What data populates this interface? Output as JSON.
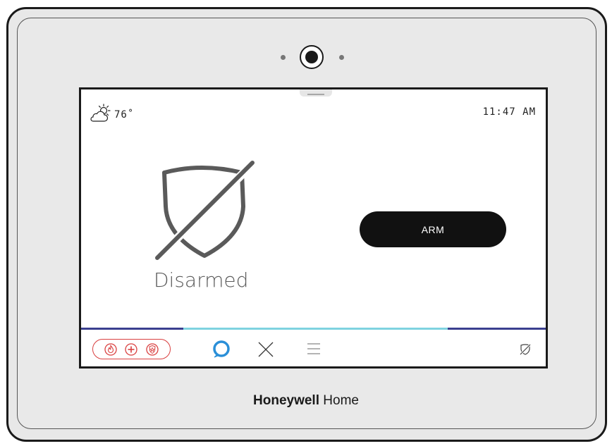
{
  "weather": {
    "temperature": "76˚",
    "icon": "partly-sunny-icon"
  },
  "clock": {
    "time": "11:47 AM"
  },
  "status": {
    "text": "Disarmed",
    "icon": "shield-slash-icon",
    "color": "#5a5a5a"
  },
  "arm_button": {
    "label": "ARM",
    "color": "#111111"
  },
  "bottom_nav": {
    "emergency_icons": [
      "fire-icon",
      "medical-cross-icon",
      "police-badge-icon"
    ],
    "emergency_color": "#d94040",
    "items": [
      "alexa-icon",
      "close-icon",
      "menu-icon",
      "disarmed-status-icon"
    ],
    "line_colors": {
      "dark": "#3a3f8f",
      "light": "#7fd3e0"
    }
  },
  "brand": {
    "bold": "Honeywell",
    "regular": " Home"
  }
}
